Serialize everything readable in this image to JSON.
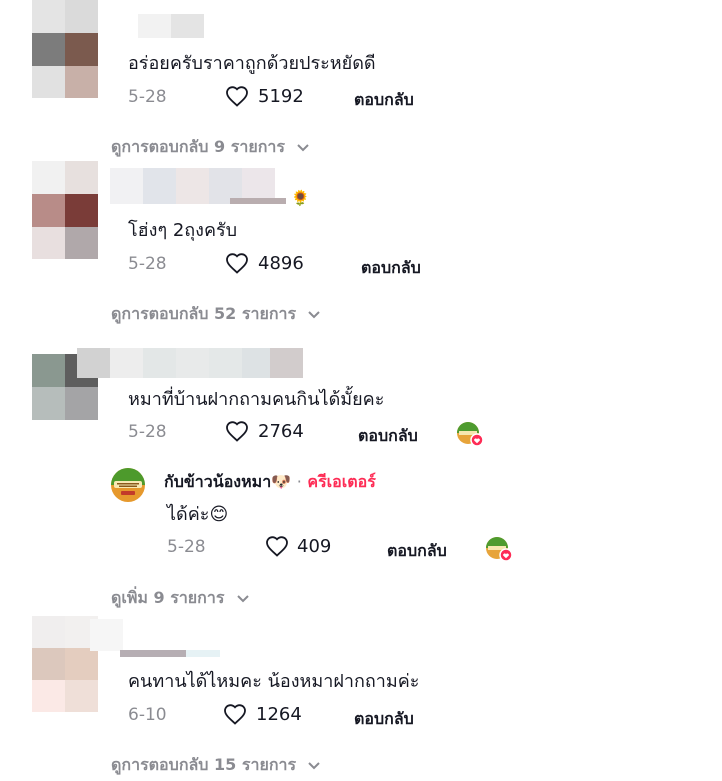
{
  "comments": [
    {
      "text": "อร่อยครับราคาถูกด้วยประหยัดดี",
      "date": "5-28",
      "likes": "5192",
      "reply_label": "ตอบกลับ",
      "view_replies": "ดูการตอบกลับ 9 รายการ"
    },
    {
      "text": "โฮ่งๆ 2ถุงครับ",
      "date": "5-28",
      "likes": "4896",
      "reply_label": "ตอบกลับ",
      "view_replies": "ดูการตอบกลับ 52 รายการ",
      "name_emoji": "🌻"
    },
    {
      "text": "หมาที่บ้านฝากถามคนกินได้มั้ยคะ",
      "date": "5-28",
      "likes": "2764",
      "reply_label": "ตอบกลับ",
      "view_more": "ดูเพิ่ม 9 รายการ",
      "reply": {
        "author": "กับข้าวน้องหมา",
        "author_emoji": "🐶",
        "separator": "·",
        "creator_label": "ครีเอเตอร์",
        "text": "ได้ค่ะ",
        "text_emoji": "😊",
        "date": "5-28",
        "likes": "409",
        "reply_label": "ตอบกลับ"
      }
    },
    {
      "text": "คนทานได้ไหมคะ น้องหมาฝากถามค่ะ",
      "date": "6-10",
      "likes": "1264",
      "reply_label": "ตอบกลับ",
      "view_replies": "ดูการตอบกลับ 15 รายการ"
    }
  ],
  "icons": {
    "heart": "heart-outline-icon",
    "chevron": "chevron-down-icon",
    "creator_liked": "creator-liked-badge-icon"
  },
  "colors": {
    "creator_accent": "#fe2c55",
    "muted_text": "#8a8b91",
    "primary_text": "#161823"
  }
}
